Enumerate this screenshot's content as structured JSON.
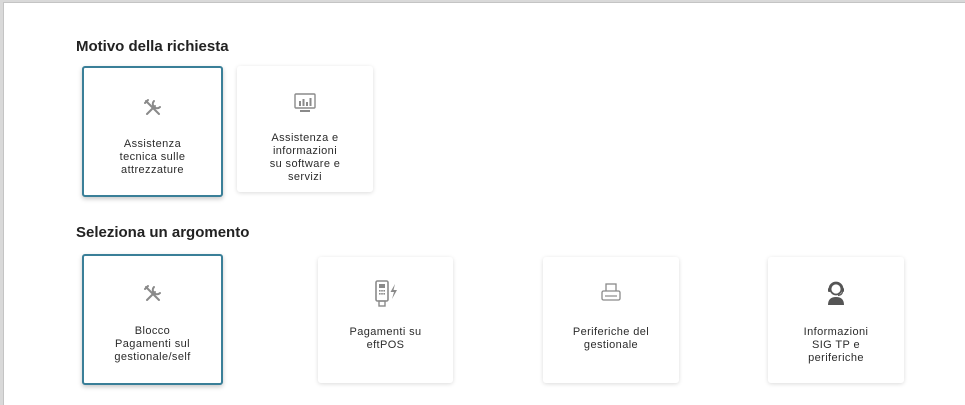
{
  "motivo": {
    "title": "Motivo della richiesta",
    "options": [
      {
        "label": "Assistenza\ntecnica sulle\nattrezzature",
        "icon": "tools-icon",
        "selected": true
      },
      {
        "label": "Assistenza e\ninformazioni\nsu software e\nservizi",
        "icon": "monitor-chart-icon",
        "selected": false
      }
    ]
  },
  "argomento": {
    "title": "Seleziona un argomento",
    "options": [
      {
        "label": "Blocco\nPagamenti sul\ngestionale/self",
        "icon": "tools-icon",
        "selected": true
      },
      {
        "label": "Pagamenti su\neftPOS",
        "icon": "pos-terminal-icon",
        "selected": false
      },
      {
        "label": "Periferiche del\ngestionale",
        "icon": "printer-icon",
        "selected": false
      },
      {
        "label": "Informazioni\nSIG TP e\nperiferiche",
        "icon": "support-agent-icon",
        "selected": false
      }
    ]
  },
  "colors": {
    "selected_border": "#3a7f98",
    "icon_gray": "#8a8a8a",
    "text": "#2b2b2b"
  }
}
